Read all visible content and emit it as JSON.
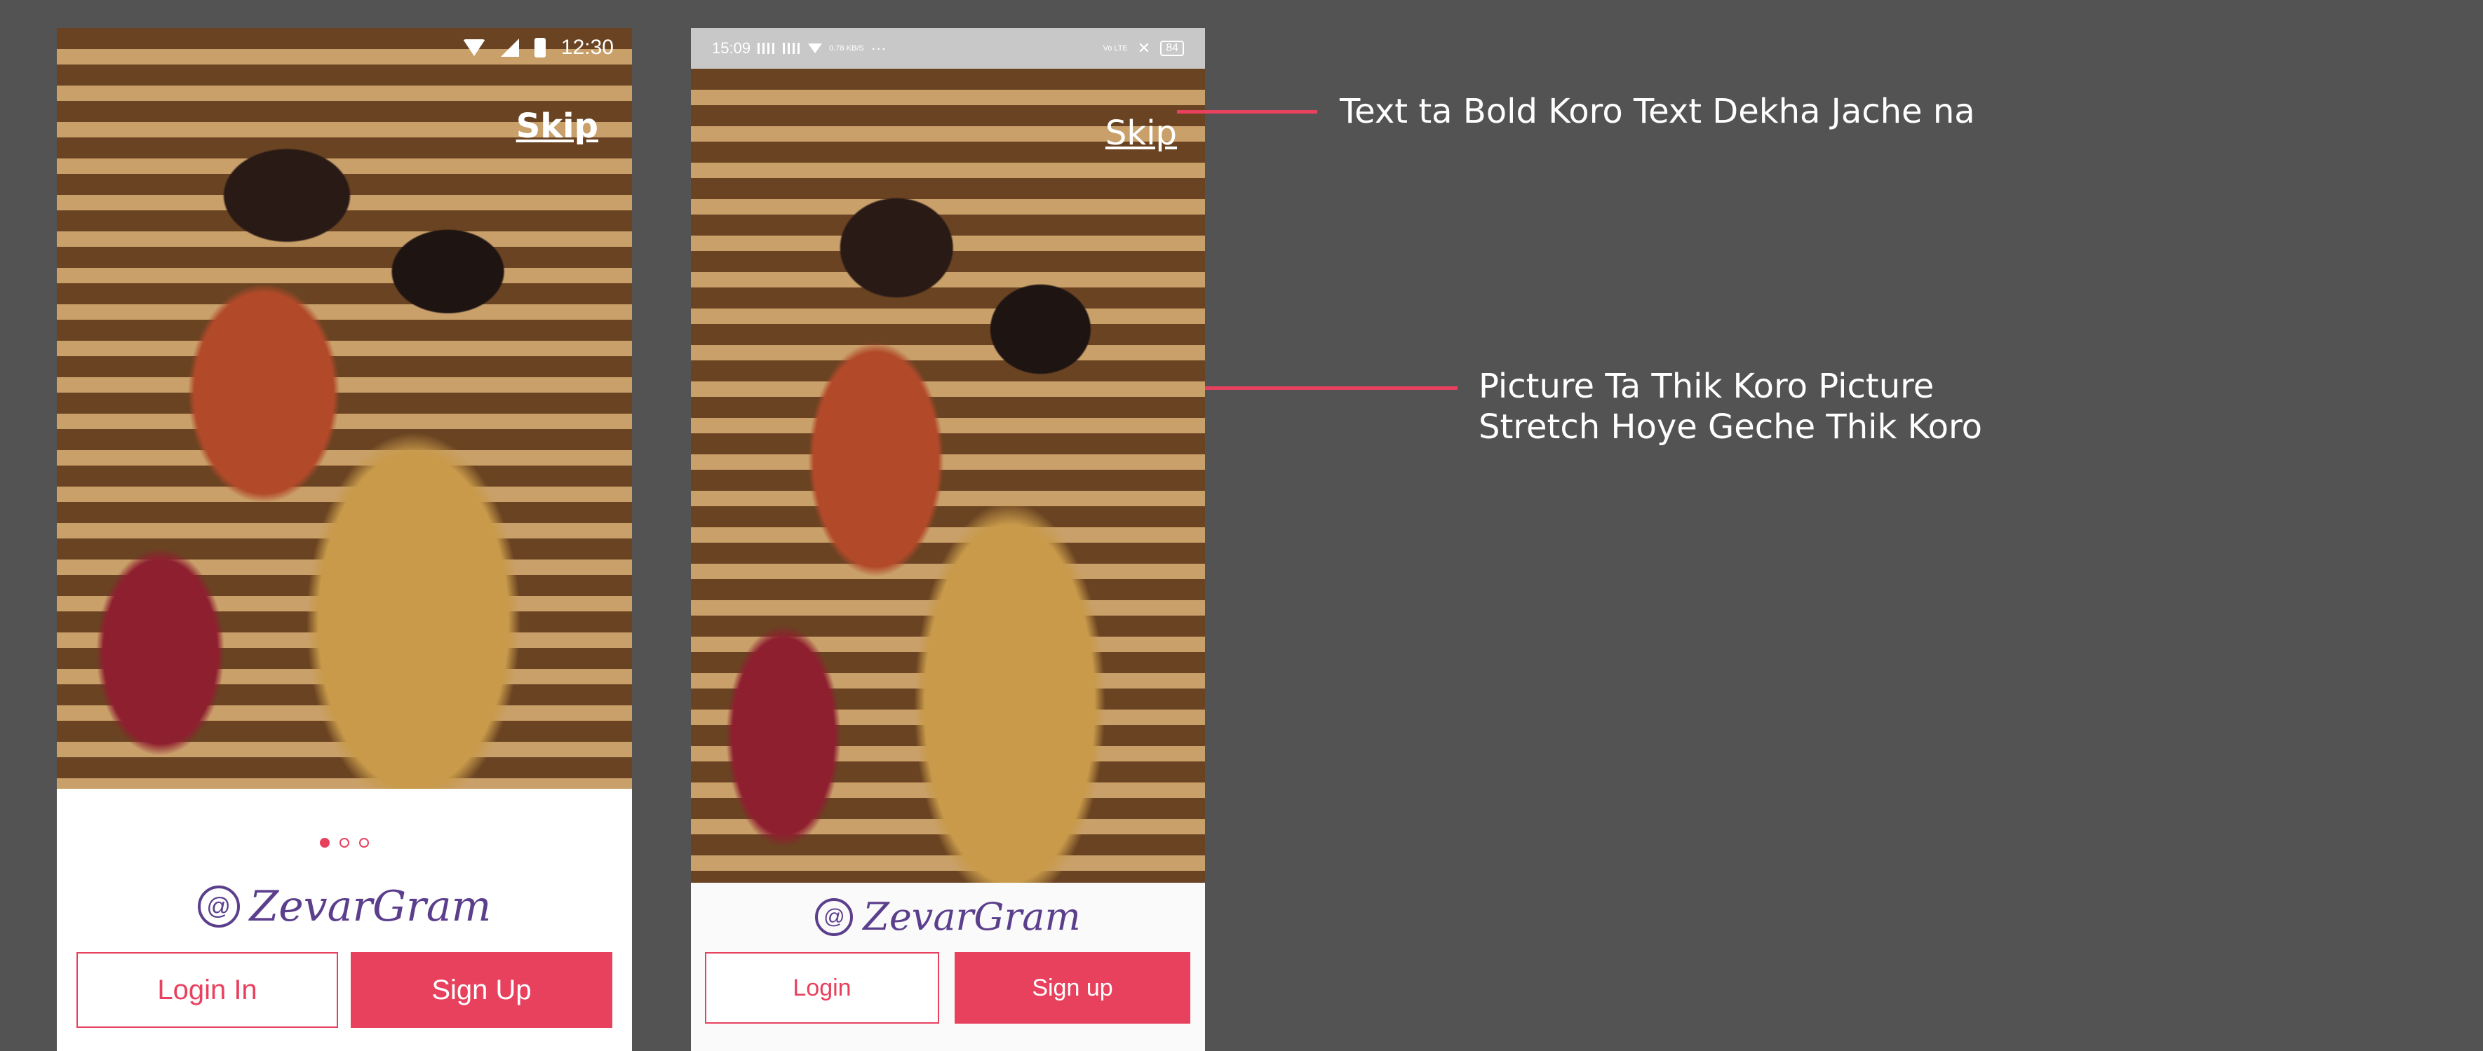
{
  "phone_a": {
    "status": {
      "time": "12:30"
    },
    "skip_label": "Skip",
    "brand_name": "ZevarGram",
    "login_label": "Login In",
    "signup_label": "Sign Up",
    "pagination": {
      "count": 3,
      "active_index": 0
    }
  },
  "phone_b": {
    "status": {
      "time": "15:09",
      "mini_text": "0.78 KB/S",
      "vol_text": "Vo LTE",
      "battery": "84"
    },
    "skip_label": "Skip",
    "brand_name": "ZevarGram",
    "login_label": "Login",
    "signup_label": "Sign up"
  },
  "notes": {
    "note_1": "Text ta Bold Koro Text Dekha Jache na",
    "note_2_line1": "Picture Ta Thik Koro Picture",
    "note_2_line2": "Stretch Hoye Geche Thik Koro"
  },
  "colors": {
    "accent": "#e8415e",
    "brand_purple": "#5b3f8c",
    "canvas": "#535353"
  }
}
